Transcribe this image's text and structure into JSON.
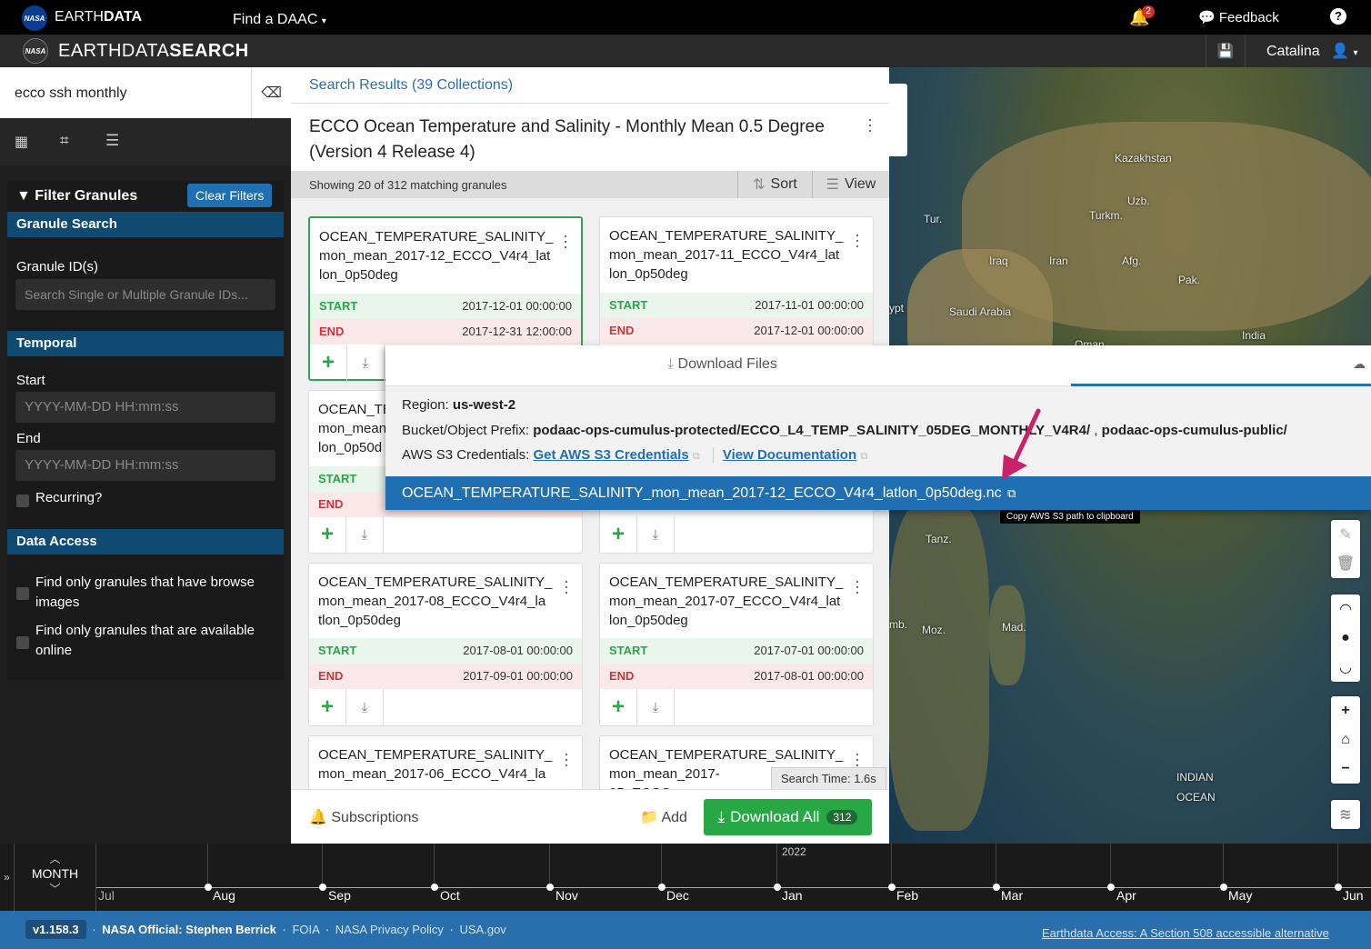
{
  "topbar": {
    "logo_text": "NASA",
    "brand": "EARTH",
    "brand_bold": "DATA",
    "find_daac": "Find a DAAC",
    "notif_count": "2",
    "feedback": "Feedback",
    "help": "?"
  },
  "appbar": {
    "title": "EARTHDATA",
    "title_bold": "SEARCH",
    "user": "Catalina"
  },
  "search": {
    "query": "ecco ssh monthly"
  },
  "sidebar": {
    "filter_title": "Filter Granules",
    "clear_filters": "Clear Filters",
    "granule_search": "Granule Search",
    "granule_ids_label": "Granule ID(s)",
    "granule_ids_placeholder": "Search Single or Multiple Granule IDs...",
    "temporal": "Temporal",
    "start_label": "Start",
    "start_placeholder": "YYYY-MM-DD HH:mm:ss",
    "end_label": "End",
    "end_placeholder": "YYYY-MM-DD HH:mm:ss",
    "recurring": "Recurring?",
    "data_access": "Data Access",
    "browse_opt": "Find only granules that have browse images",
    "online_opt": "Find only granules that are available online"
  },
  "results": {
    "breadcrumb": "Search Results (39 Collections)",
    "collection_title": "ECCO Ocean Temperature and Salinity - Monthly Mean 0.5 Degree (Version 4 Release 4)",
    "showing": "Showing 20 of 312 matching granules",
    "sort": "Sort",
    "view": "View",
    "start_key": "START",
    "end_key": "END",
    "granules": [
      {
        "name": "OCEAN_TEMPERATURE_SALINITY_ mon_mean_2017-12_ECCO_V4r4_lat lon_0p50deg",
        "start": "2017-12-01 00:00:00",
        "end": "2017-12-31 12:00:00"
      },
      {
        "name": "OCEAN_TEMPERATURE_SALINITY_ mon_mean_2017-11_ECCO_V4r4_lat lon_0p50deg",
        "start": "2017-11-01 00:00:00",
        "end": "2017-12-01 00:00:00"
      },
      {
        "name": "OCEAN_TE mon_mean lon_0p50d",
        "start": "",
        "end": ""
      },
      {
        "name": "",
        "start": "",
        "end": ""
      },
      {
        "name": "OCEAN_TEMPERATURE_SALINITY_ mon_mean_2017-08_ECCO_V4r4_la tlon_0p50deg",
        "start": "2017-08-01 00:00:00",
        "end": "2017-09-01 00:00:00"
      },
      {
        "name": "OCEAN_TEMPERATURE_SALINITY_ mon_mean_2017-07_ECCO_V4r4_lat lon_0p50deg",
        "start": "2017-07-01 00:00:00",
        "end": "2017-08-01 00:00:00"
      },
      {
        "name": "OCEAN_TEMPERATURE_SALINITY_ mon_mean_2017-06_ECCO_V4r4_la",
        "start": "",
        "end": ""
      },
      {
        "name": "OCEAN_TEMPERATURE_SALINITY_ mon_mean_2017-05_ECCO",
        "start": "",
        "end": ""
      }
    ],
    "search_time": "Search Time: 1.6s",
    "subscriptions": "Subscriptions",
    "add": "Add",
    "download_all": "Download All",
    "download_count": "312"
  },
  "download": {
    "tab": "Download Files",
    "region_label": "Region:",
    "region": "us-west-2",
    "bucket_label": "Bucket/Object Prefix:",
    "bucket": "podaac-ops-cumulus-protected/ECCO_L4_TEMP_SALINITY_05DEG_MONTHLY_V4R4/",
    "bucket_sep": ",",
    "bucket2": "podaac-ops-cumulus-public/",
    "creds_label": "AWS S3 Credentials:",
    "get_creds": "Get AWS S3 Credentials",
    "view_docs": "View Documentation",
    "file": "OCEAN_TEMPERATURE_SALINITY_mon_mean_2017-12_ECCO_V4r4_latlon_0p50deg.nc",
    "tooltip": "Copy AWS S3 path to clipboard"
  },
  "map": {
    "labels": [
      "Kazakhstan",
      "Uzb.",
      "Turkm.",
      "Tur.",
      "Iraq",
      "Iran",
      "Afg.",
      "Pak.",
      "Saudi Arabia",
      "India",
      "ypt",
      "Oman",
      "Tanz.",
      "Moz.",
      "Mad.",
      "mb.",
      "INDIAN",
      "OCEAN"
    ]
  },
  "timeline": {
    "zoom": "MONTH",
    "year": "2022",
    "months": [
      "Jul",
      "Aug",
      "Sep",
      "Oct",
      "Nov",
      "Dec",
      "Jan",
      "Feb",
      "Mar",
      "Apr",
      "May",
      "Jun"
    ]
  },
  "footer": {
    "version": "v1.158.3",
    "official": "NASA Official: Stephen Berrick",
    "foia": "FOIA",
    "privacy": "NASA Privacy Policy",
    "usa": "USA.gov",
    "accessible": "Earthdata Access: A Section 508 accessible alternative"
  }
}
